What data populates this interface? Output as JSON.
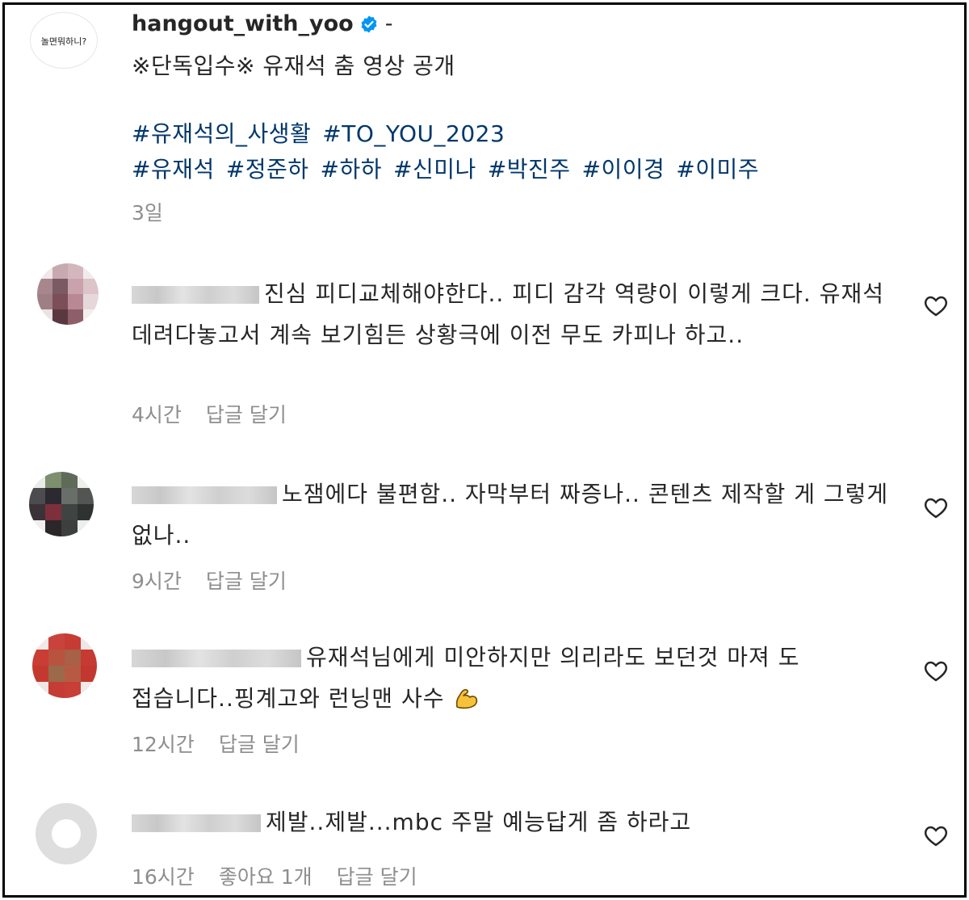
{
  "post": {
    "username": "hangout_with_yoo",
    "suffix": "-",
    "caption": "※단독입수※ 유재석 춤 영상 공개",
    "hashtags_line1": [
      "#유재석의_사생활",
      "#TO_YOU_2023"
    ],
    "hashtags_line2": [
      "#유재석",
      "#정준하",
      "#하하",
      "#신미나",
      "#박진주",
      "#이이경",
      "#이미주"
    ],
    "time": "3일",
    "logo_text": "놀면뭐하니?"
  },
  "comments": [
    {
      "text": "진심 피디교체해야한다.. 피디 감각 역량이 이렇게 크다. 유재석 데려다놓고서 계속 보기힘든 상황극에 이전 무도 카피나 하고..",
      "time": "4시간",
      "reply": "답글 달기"
    },
    {
      "text": "노잼에다 불편함.. 자막부터 짜증나.. 콘텐츠 제작할 게 그렇게 없나..",
      "time": "9시간",
      "reply": "답글 달기"
    },
    {
      "text": "유재석님에게 미안하지만 의리라도 보던것 마져 도 접습니다..핑계고와 런닝맨 사수",
      "time": "12시간",
      "reply": "답글 달기",
      "emoji": "flexed-biceps"
    },
    {
      "text": "제발..제발...mbc 주말 예능답게 좀 하라고",
      "time": "16시간",
      "likes": "좋아요 1개",
      "reply": "답글 달기"
    }
  ],
  "colors": {
    "text": "#262626",
    "muted": "#8e8e8e",
    "hashtag": "#00376b",
    "verified": "#0095f6"
  },
  "icons": [
    "verified-badge-icon",
    "heart-icon",
    "flexed-biceps-emoji"
  ]
}
